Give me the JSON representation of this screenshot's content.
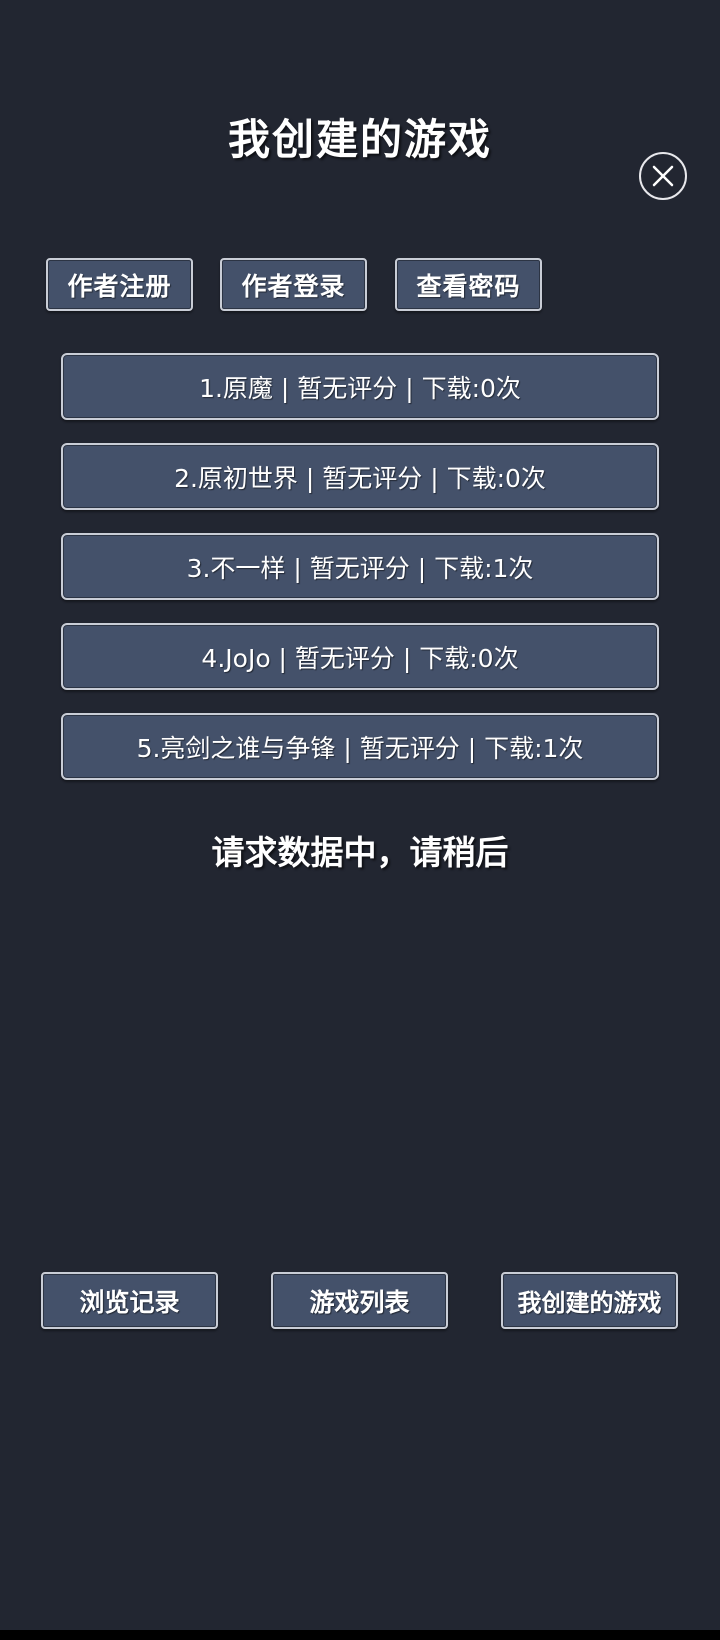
{
  "header": {
    "title": "我创建的游戏"
  },
  "top_buttons": {
    "register": "作者注册",
    "login": "作者登录",
    "view_password": "查看密码"
  },
  "games": [
    {
      "label": "1.原魔 | 暂无评分 | 下载:0次"
    },
    {
      "label": "2.原初世界 | 暂无评分 | 下载:0次"
    },
    {
      "label": "3.不一样 | 暂无评分 | 下载:1次"
    },
    {
      "label": "4.JoJo | 暂无评分 | 下载:0次"
    },
    {
      "label": "5.亮剑之谁与争锋 | 暂无评分 | 下载:1次"
    }
  ],
  "status_text": "请求数据中，请稍后",
  "bottom_nav": {
    "history": "浏览记录",
    "game_list": "游戏列表",
    "my_games": "我创建的游戏"
  },
  "icons": {
    "close": "close-icon"
  },
  "colors": {
    "background": "#222631",
    "button_fill": "#44516a",
    "button_border": "#c9cdd6"
  }
}
